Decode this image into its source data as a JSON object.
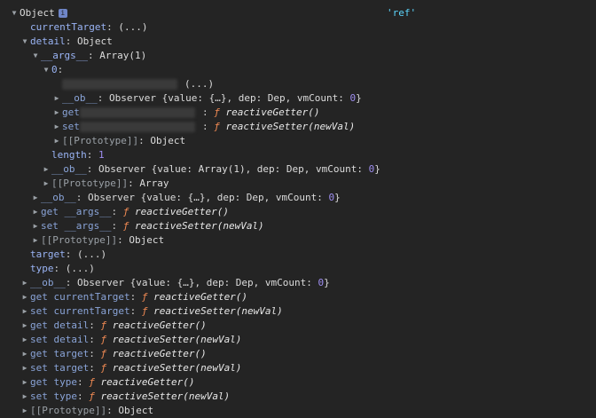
{
  "header": {
    "label": "Object",
    "badge": "i",
    "ref_string": "'ref'"
  },
  "rows": {
    "currentTarget": {
      "key": "currentTarget",
      "value": "(...)"
    },
    "detail": {
      "key": "detail",
      "value": "Object"
    },
    "args": {
      "key": "__args__",
      "value": "Array(1)"
    },
    "idx0": {
      "key": "0"
    },
    "hidden_prop": {
      "value": "(...)"
    },
    "inner_ob": {
      "key": "__ob__",
      "value": "Observer {value: {…}, dep: Dep, vmCount: ",
      "count": "0",
      "close": "}"
    },
    "inner_get": {
      "prefix": "get",
      "fn": "reactiveGetter()"
    },
    "inner_set": {
      "prefix": "set",
      "fn": "reactiveSetter(newVal)"
    },
    "inner_proto": {
      "key": "[[Prototype]]",
      "value": "Object"
    },
    "length": {
      "key": "length",
      "value": "1"
    },
    "array_ob": {
      "key": "__ob__",
      "value": "Observer {value: Array(1), dep: Dep, vmCount: ",
      "count": "0",
      "close": "}"
    },
    "array_proto": {
      "key": "[[Prototype]]",
      "value": "Array"
    },
    "detail_ob": {
      "key": "__ob__",
      "value": "Observer {value: {…}, dep: Dep, vmCount: ",
      "count": "0",
      "close": "}"
    },
    "get_args": {
      "key": "get __args__",
      "fn": "reactiveGetter()"
    },
    "set_args": {
      "key": "set __args__",
      "fn": "reactiveSetter(newVal)"
    },
    "detail_proto": {
      "key": "[[Prototype]]",
      "value": "Object"
    },
    "target": {
      "key": "target",
      "value": "(...)"
    },
    "type": {
      "key": "type",
      "value": "(...)"
    },
    "root_ob": {
      "key": "__ob__",
      "value": "Observer {value: {…}, dep: Dep, vmCount: ",
      "count": "0",
      "close": "}"
    },
    "get_currentTarget": {
      "key": "get currentTarget",
      "fn": "reactiveGetter()"
    },
    "set_currentTarget": {
      "key": "set currentTarget",
      "fn": "reactiveSetter(newVal)"
    },
    "get_detail": {
      "key": "get detail",
      "fn": "reactiveGetter()"
    },
    "set_detail": {
      "key": "set detail",
      "fn": "reactiveSetter(newVal)"
    },
    "get_target": {
      "key": "get target",
      "fn": "reactiveGetter()"
    },
    "set_target": {
      "key": "set target",
      "fn": "reactiveSetter(newVal)"
    },
    "get_type": {
      "key": "get type",
      "fn": "reactiveGetter()"
    },
    "set_type": {
      "key": "set type",
      "fn": "reactiveSetter(newVal)"
    },
    "root_proto": {
      "key": "[[Prototype]]",
      "value": "Object"
    }
  },
  "symbols": {
    "expanded": "▼",
    "collapsed": "▶",
    "fn": "ƒ",
    "colon": ":"
  },
  "colors": {
    "background": "#242424",
    "key": "#9ab4f5",
    "number": "#9e8ef0",
    "string": "#5cd5fb",
    "function": "#f28b54"
  }
}
